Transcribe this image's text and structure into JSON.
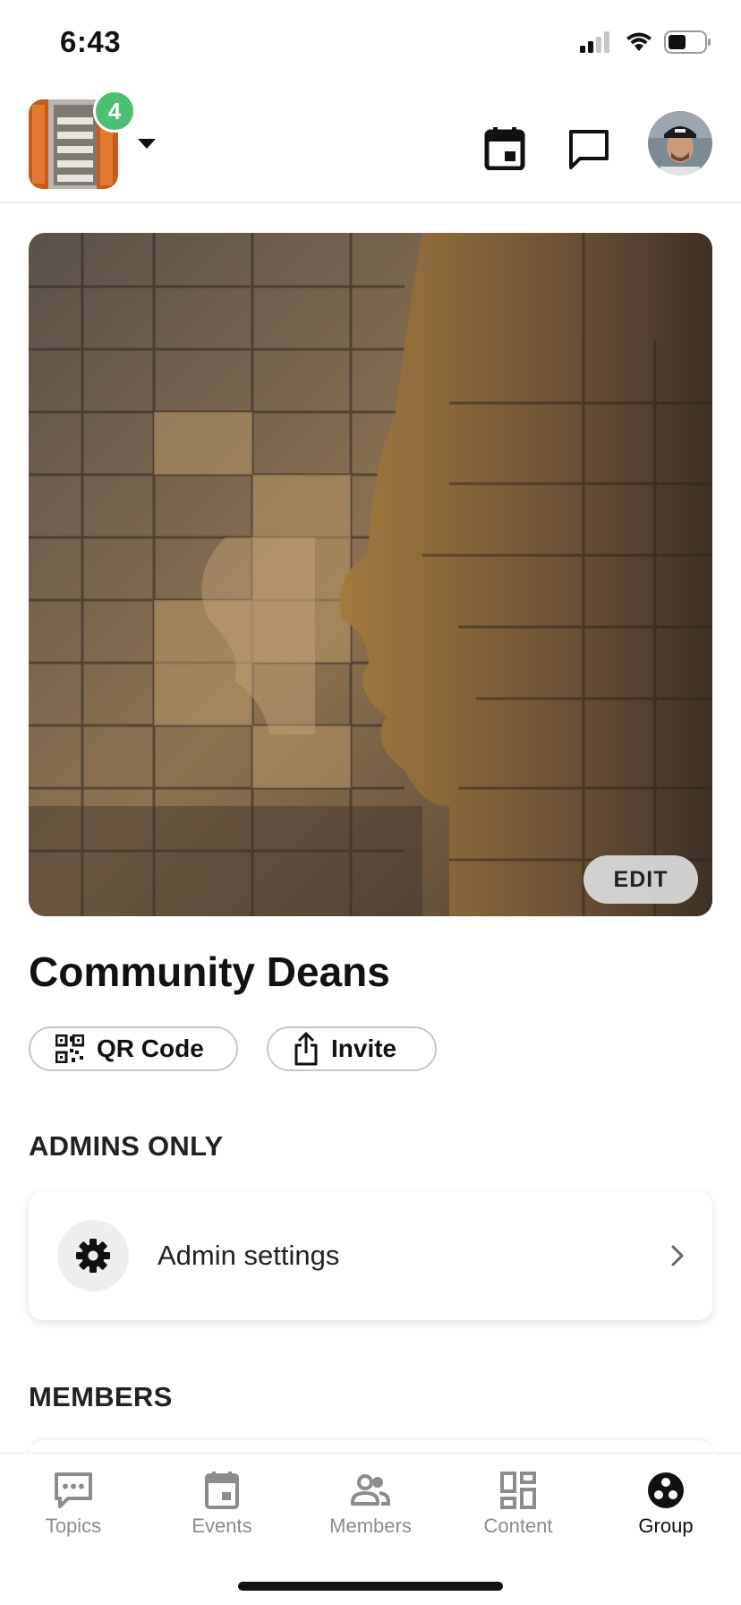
{
  "status_bar": {
    "time": "6:43"
  },
  "header": {
    "group_badge_count": "4",
    "icons": [
      "calendar-icon",
      "chat-icon"
    ]
  },
  "cover": {
    "edit_label": "EDIT"
  },
  "group": {
    "title": "Community Deans"
  },
  "actions": {
    "qr_label": "QR Code",
    "invite_label": "Invite"
  },
  "sections": {
    "admins_heading": "ADMINS ONLY",
    "members_heading": "MEMBERS"
  },
  "admin_card": {
    "label": "Admin settings"
  },
  "tabs": [
    {
      "label": "Topics",
      "icon": "topics-icon",
      "active": false
    },
    {
      "label": "Events",
      "icon": "events-icon",
      "active": false
    },
    {
      "label": "Members",
      "icon": "members-icon",
      "active": false
    },
    {
      "label": "Content",
      "icon": "content-icon",
      "active": false
    },
    {
      "label": "Group",
      "icon": "group-icon",
      "active": true
    }
  ],
  "colors": {
    "badge": "#4cbf73",
    "tab_inactive": "#8c8c8c",
    "tab_active": "#111111"
  }
}
